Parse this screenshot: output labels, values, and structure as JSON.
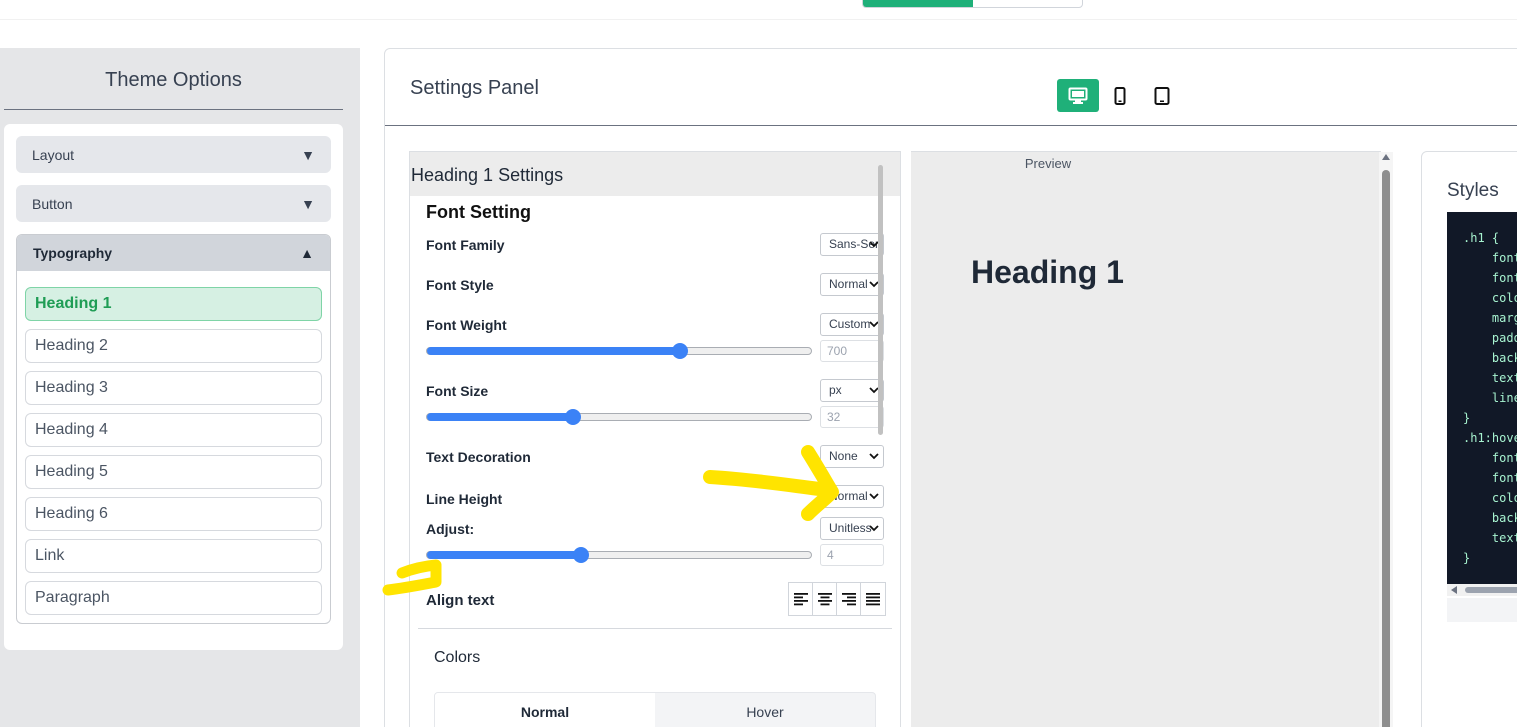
{
  "sidebar": {
    "title": "Theme Options",
    "accordions": [
      {
        "label": "Layout",
        "expanded": false
      },
      {
        "label": "Button",
        "expanded": false
      },
      {
        "label": "Typography",
        "expanded": true
      }
    ],
    "typography_items": [
      "Heading 1",
      "Heading 2",
      "Heading 3",
      "Heading 4",
      "Heading 5",
      "Heading 6",
      "Link",
      "Paragraph"
    ],
    "active_item": "Heading 1"
  },
  "main": {
    "title": "Settings Panel",
    "devices": [
      "desktop-icon",
      "mobile-icon",
      "tablet-icon"
    ],
    "active_device": "desktop"
  },
  "settings": {
    "title": "Heading 1 Settings",
    "section_title": "Font Setting",
    "font_family": {
      "label": "Font Family",
      "value": "Sans-Serif"
    },
    "font_style": {
      "label": "Font Style",
      "value": "Normal"
    },
    "font_weight": {
      "label": "Font Weight",
      "value": "Custom",
      "number": "700",
      "slider_fraction": 0.66
    },
    "font_size": {
      "label": "Font Size",
      "unit": "px",
      "number": "32",
      "slider_fraction": 0.38
    },
    "text_decoration": {
      "label": "Text Decoration",
      "value": "None"
    },
    "line_height": {
      "label": "Line Height",
      "value": "Normal"
    },
    "adjust": {
      "label": "Adjust:",
      "unit": "Unitless",
      "number": "4",
      "slider_fraction": 0.4
    },
    "align_text": {
      "label": "Align text",
      "options": [
        "align-left-icon",
        "align-center-icon",
        "align-right-icon",
        "align-justify-icon"
      ]
    },
    "colors_label": "Colors",
    "color_tabs": [
      "Normal",
      "Hover"
    ],
    "active_color_tab": "Normal"
  },
  "preview": {
    "label": "Preview",
    "heading": "Heading 1"
  },
  "styles": {
    "title": "Styles",
    "code": ".h1 {\n    font\n    font\n    colo\n    marg\n    padd\n    back\n    text\n    line\n}\n.h1:hove\n    font\n    font\n    colo\n    back\n    text\n}"
  },
  "colors": {
    "accent": "#1fb079",
    "slider": "#3b82f6",
    "annotation": "#ffe400"
  }
}
